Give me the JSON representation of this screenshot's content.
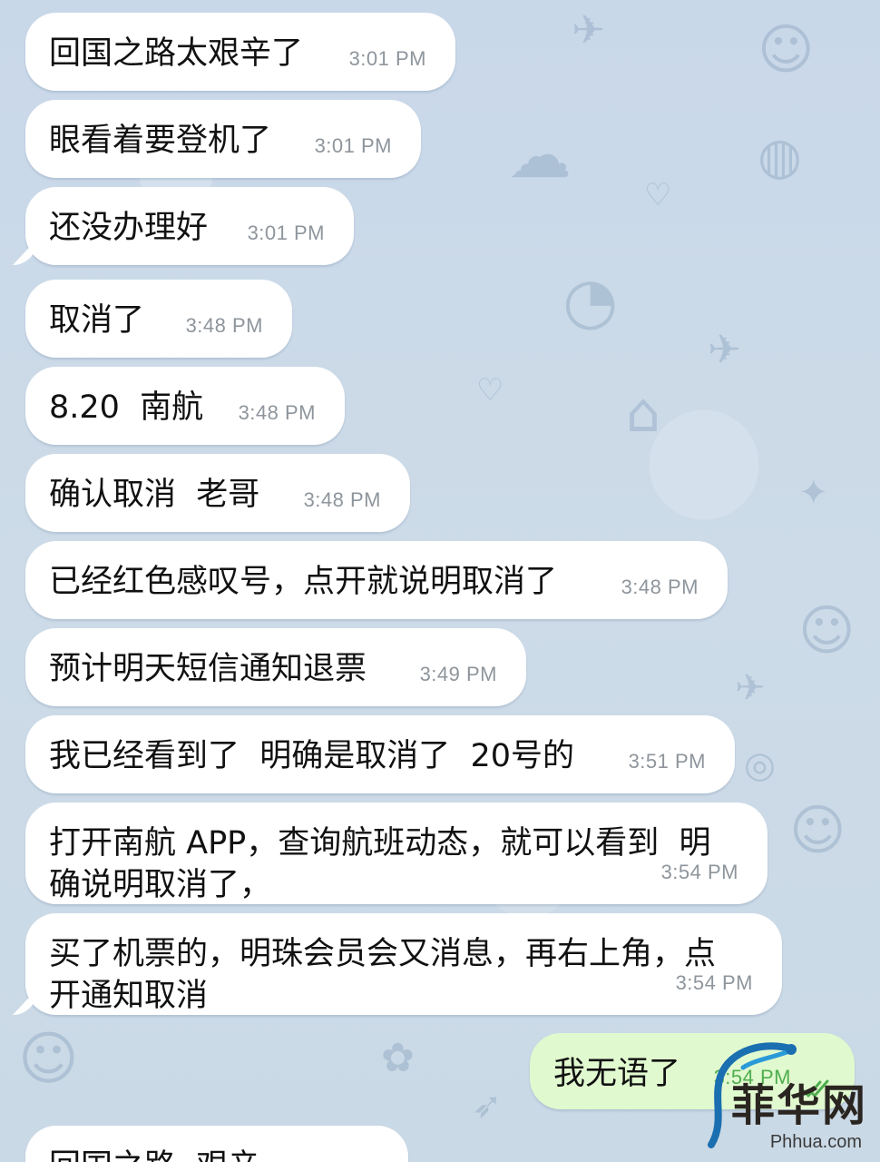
{
  "messages": [
    {
      "text": "回国之路太艰辛了",
      "time": "3:01 PM"
    },
    {
      "text": "眼看着要登机了",
      "time": "3:01 PM"
    },
    {
      "text": "还没办理好",
      "time": "3:01 PM"
    },
    {
      "text": "取消了",
      "time": "3:48 PM"
    },
    {
      "text": "8.20  南航",
      "time": "3:48 PM"
    },
    {
      "text": "确认取消  老哥",
      "time": "3:48 PM"
    },
    {
      "text": "已经红色感叹号，点开就说明取消了",
      "time": "3:48 PM"
    },
    {
      "text": "预计明天短信通知退票",
      "time": "3:49 PM"
    },
    {
      "text": "我已经看到了  明确是取消了  20号的",
      "time": "3:51 PM"
    },
    {
      "text": "打开南航 APP，查询航班动态，就可以看到  明\n确说明取消了，",
      "time": "3:54 PM"
    },
    {
      "text": "买了机票的，明珠会员会又消息，再右上角，点\n开通知取消",
      "time": "3:54 PM"
    },
    {
      "text": "回国之路  艰辛",
      "time": ""
    }
  ],
  "outgoing": {
    "text": "我无语了",
    "time": "3:54 PM"
  },
  "watermark": {
    "text": "菲华网",
    "url": "Phhua.com"
  },
  "colors": {
    "incoming": "#ffffff",
    "outgoing": "#e1f9cf",
    "check": "#4fae4e",
    "background": "#cbd9e8"
  }
}
